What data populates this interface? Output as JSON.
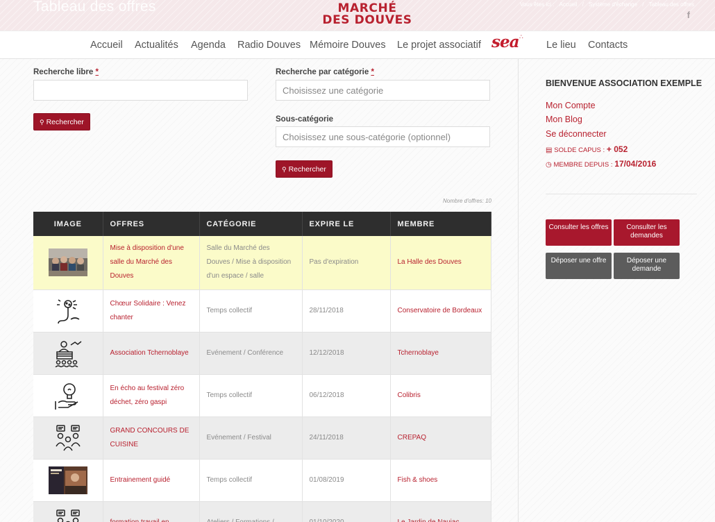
{
  "header": {
    "page_title": "Tableau des offres",
    "logo_line1": "MARCHÉ",
    "logo_line2": "DES DOUVES",
    "breadcrumb_prefix": "Vous êtes ici :",
    "breadcrumb": [
      "Accueil",
      "/",
      "Système d'échange",
      "/",
      "Tableau des offres"
    ],
    "facebook_icon": "facebook-icon",
    "accent_color": "#b8212f"
  },
  "nav": {
    "items": [
      "Accueil",
      "Actualités",
      "Agenda",
      "Radio Douves",
      "Mémoire Douves",
      "Le projet associatif",
      "Le lieu",
      "Contacts"
    ],
    "sea_logo": "sea"
  },
  "search": {
    "free_label": "Recherche libre",
    "free_value": "",
    "category_label": "Recherche par catégorie",
    "category_placeholder": "Choisissez une catégorie",
    "subcategory_label": "Sous-catégorie",
    "subcategory_placeholder": "Choisissez une sous-catégorie (optionnel)",
    "button_label": "Rechercher",
    "required_mark": "*"
  },
  "results": {
    "count_text": "Nombre d'offres: 10",
    "columns": [
      "IMAGE",
      "OFFRES",
      "CATÉGORIE",
      "EXPIRE LE",
      "MEMBRE"
    ],
    "rows": [
      {
        "image": "photo-group-icon",
        "offer": "Mise à disposition d'une salle du Marché des Douves",
        "category": "Salle du Marché des Douves / Mise à disposition d'un espace / salle",
        "expires": "Pas d'expiration",
        "member": "La Halle des Douves"
      },
      {
        "image": "singing-microphone-icon",
        "offer": "Chœur Solidaire : Venez chanter",
        "category": "Temps collectif",
        "expires": "28/11/2018",
        "member": "Conservatoire de Bordeaux"
      },
      {
        "image": "conference-icon",
        "offer": "Association Tchernoblaye",
        "category": "Evénement / Conférence",
        "expires": "12/12/2018",
        "member": "Tchernoblaye"
      },
      {
        "image": "idea-hand-icon",
        "offer": "En écho au festival zéro déchet, zéro gaspi",
        "category": "Temps collectif",
        "expires": "06/12/2018",
        "member": "Colibris"
      },
      {
        "image": "discussion-people-icon",
        "offer": "GRAND CONCOURS DE CUISINE",
        "category": "Evénement / Festival",
        "expires": "24/11/2018",
        "member": "CREPAQ"
      },
      {
        "image": "poster-photo-icon",
        "offer": "Entrainement guidé",
        "category": "Temps collectif",
        "expires": "01/08/2019",
        "member": "Fish & shoes"
      },
      {
        "image": "discussion-people-icon",
        "offer": "formation travail en",
        "category": "Ateliers / Formations /",
        "expires": "01/10/2020",
        "member": "Le Jardin de Naujac"
      }
    ]
  },
  "sidebar": {
    "welcome": "BIENVENUE ASSOCIATION EXEMPLE",
    "links": [
      "Mon Compte",
      "Mon Blog",
      "Se déconnecter"
    ],
    "balance_label": "SOLDE CAPUS :",
    "balance_value": "+ 052",
    "member_since_label": "MEMBRE DEPUIS :",
    "member_since_value": "17/04/2016",
    "buttons": [
      "Consulter les offres",
      "Consulter les demandes",
      "Déposer une offre",
      "Déposer une demande"
    ]
  }
}
